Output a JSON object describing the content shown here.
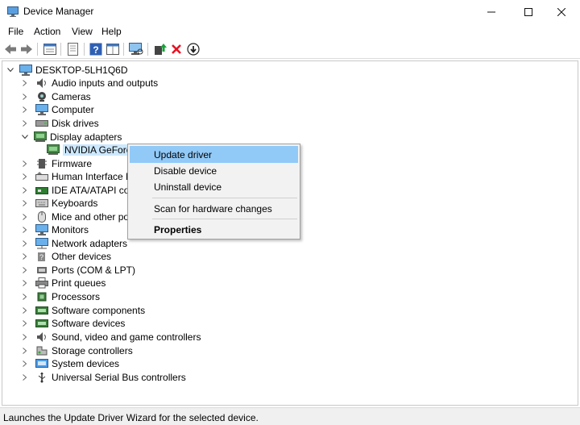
{
  "window": {
    "title": "Device Manager"
  },
  "menu": [
    "File",
    "Action",
    "View",
    "Help"
  ],
  "tree": {
    "root": "DESKTOP-5LH1Q6D",
    "categories": [
      "Audio inputs and outputs",
      "Cameras",
      "Computer",
      "Disk drives",
      "Display adapters",
      "NVIDIA GeForce",
      "Firmware",
      "Human Interface De",
      "IDE ATA/ATAPI contr",
      "Keyboards",
      "Mice and other poin",
      "Monitors",
      "Network adapters",
      "Other devices",
      "Ports (COM & LPT)",
      "Print queues",
      "Processors",
      "Software components",
      "Software devices",
      "Sound, video and game controllers",
      "Storage controllers",
      "System devices",
      "Universal Serial Bus controllers"
    ]
  },
  "context_menu": {
    "update": "Update driver",
    "disable": "Disable device",
    "uninstall": "Uninstall device",
    "scan": "Scan for hardware changes",
    "properties": "Properties"
  },
  "status": "Launches the Update Driver Wizard for the selected device.",
  "colors": {
    "selection": "#cce8ff",
    "menu_highlight": "#91c9f7",
    "uninstall_x": "#e81123",
    "update_arrow": "#1aa33a"
  }
}
